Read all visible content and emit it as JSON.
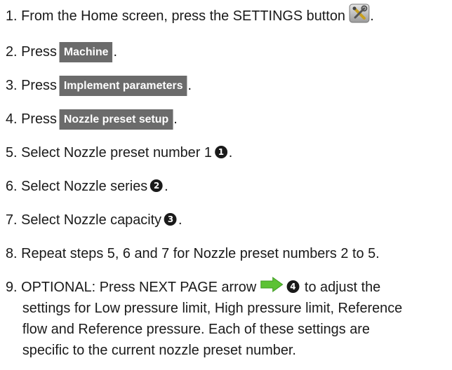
{
  "steps": [
    {
      "number": "1.",
      "text": "From the Home screen, press the SETTINGS button",
      "icon": "settings-tools-icon",
      "suffix": "."
    },
    {
      "number": "2.",
      "text": "Press",
      "button": "Machine",
      "suffix": "."
    },
    {
      "number": "3.",
      "text": "Press",
      "button": "Implement parameters",
      "suffix": "."
    },
    {
      "number": "4.",
      "text": "Press",
      "button": "Nozzle preset setup",
      "suffix": "."
    },
    {
      "number": "5.",
      "text": "Select Nozzle preset number 1",
      "callout": "1",
      "suffix": "."
    },
    {
      "number": "6.",
      "text": "Select Nozzle series",
      "callout": "2",
      "suffix": "."
    },
    {
      "number": "7.",
      "text": "Select Nozzle capacity",
      "callout": "3",
      "suffix": "."
    },
    {
      "number": "8.",
      "text": "Repeat steps 5, 6 and 7 for Nozzle preset numbers 2 to 5."
    },
    {
      "number": "9.",
      "text_before": "OPTIONAL: Press NEXT PAGE arrow",
      "icon": "next-page-arrow-icon",
      "callout": "4",
      "text_after": "to adjust the",
      "continuation": [
        "settings for Low pressure limit, High pressure limit, Reference",
        "flow and Reference pressure. Each of these settings are",
        "specific to the current nozzle preset number."
      ]
    }
  ],
  "colors": {
    "button_bg": "#6b6b6b",
    "arrow": "#5cc234",
    "text": "#1a1a1a"
  }
}
